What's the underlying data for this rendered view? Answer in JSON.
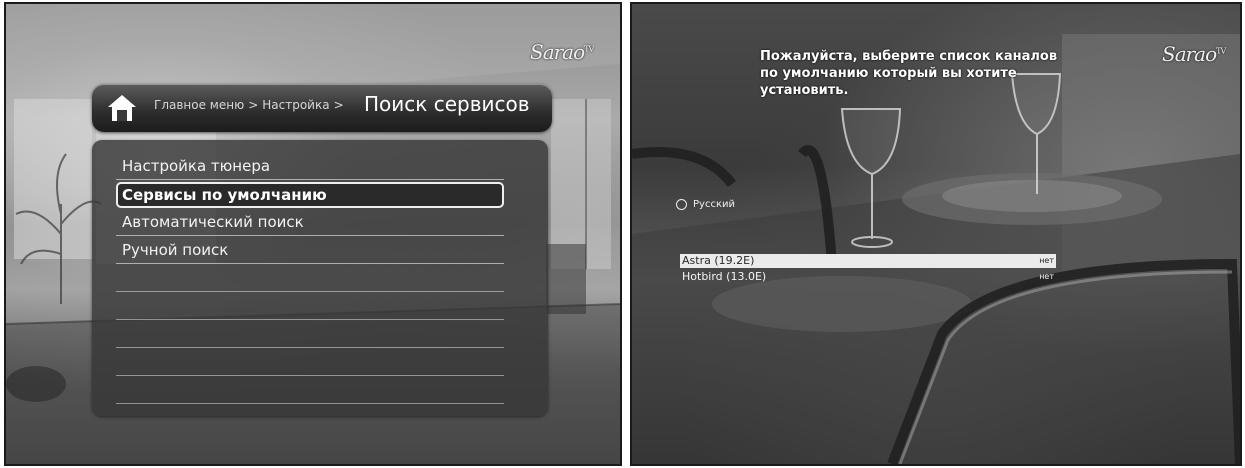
{
  "left_screen": {
    "logo": {
      "text": "Sarao",
      "sup": "TV"
    },
    "breadcrumb": [
      "Главное меню",
      "Настройка"
    ],
    "breadcrumb_separator": ">",
    "page_title": "Поиск сервисов",
    "menu_items": [
      {
        "label": "Настройка тюнера",
        "selected": false
      },
      {
        "label": "Сервисы по умолчанию",
        "selected": true
      },
      {
        "label": "Автоматический поиск",
        "selected": false
      },
      {
        "label": "Ручной поиск",
        "selected": false
      }
    ]
  },
  "right_screen": {
    "logo": {
      "text": "Sarao",
      "sup": "TV"
    },
    "prompt": "Пожалуйста, выберите список каналов по умолчанию который вы хотите установить.",
    "language_option": "Русский",
    "satellites": [
      {
        "name": "Astra (19.2E)",
        "value": "нет",
        "selected": true
      },
      {
        "name": "Hotbird (13.0E)",
        "value": "нет",
        "selected": false
      }
    ]
  },
  "colors": {
    "selection_border": "#eeeeee",
    "panel_bg": "#373737",
    "highlight_row": "#ebebeb"
  }
}
